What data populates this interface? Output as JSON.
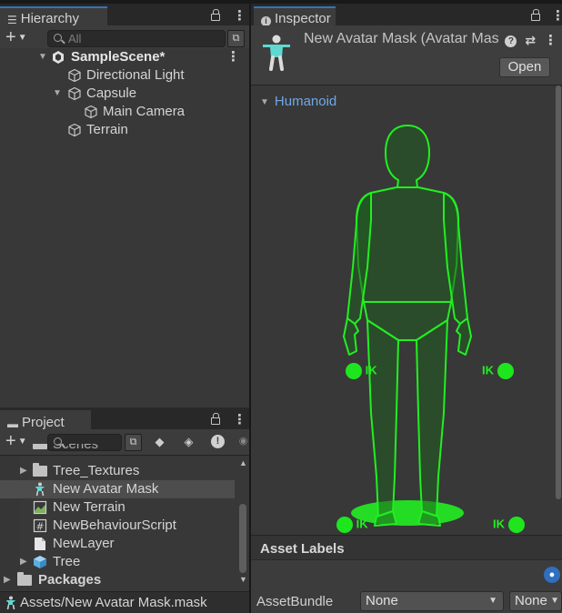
{
  "hierarchy": {
    "tab_label": "Hierarchy",
    "search_placeholder": "All",
    "items": [
      {
        "label": "SampleScene*",
        "depth": 0,
        "kind": "scene",
        "expanded": true
      },
      {
        "label": "Directional Light",
        "depth": 1,
        "kind": "gameobject"
      },
      {
        "label": "Capsule",
        "depth": 1,
        "kind": "gameobject",
        "expanded": true
      },
      {
        "label": "Main Camera",
        "depth": 2,
        "kind": "gameobject"
      },
      {
        "label": "Terrain",
        "depth": 1,
        "kind": "gameobject"
      }
    ]
  },
  "project": {
    "tab_label": "Project",
    "items": [
      {
        "label": "Scenes",
        "icon": "folder-icon"
      },
      {
        "label": "Tree_Textures",
        "icon": "folder-icon"
      },
      {
        "label": "New Avatar Mask",
        "icon": "avatar-mask-icon",
        "selected": true
      },
      {
        "label": "New Terrain",
        "icon": "terrain-icon"
      },
      {
        "label": "NewBehaviourScript",
        "icon": "script-icon"
      },
      {
        "label": "NewLayer",
        "icon": "file-icon"
      },
      {
        "label": "Tree",
        "icon": "prefab-icon"
      },
      {
        "label": "Packages",
        "icon": "folder-icon"
      }
    ],
    "status_path": "Assets/New Avatar Mask.mask"
  },
  "inspector": {
    "tab_label": "Inspector",
    "title": "New Avatar Mask (Avatar Mask)",
    "open_label": "Open",
    "humanoid_label": "Humanoid",
    "ik_label": "IK",
    "asset_labels_title": "Asset Labels",
    "assetbundle_label": "AssetBundle",
    "assetbundle_value": "None",
    "variant_value": "None"
  },
  "colors": {
    "accent": "#3a72b0",
    "mask_green": "#22ee22",
    "humanoid_link": "#6fa8e8"
  }
}
